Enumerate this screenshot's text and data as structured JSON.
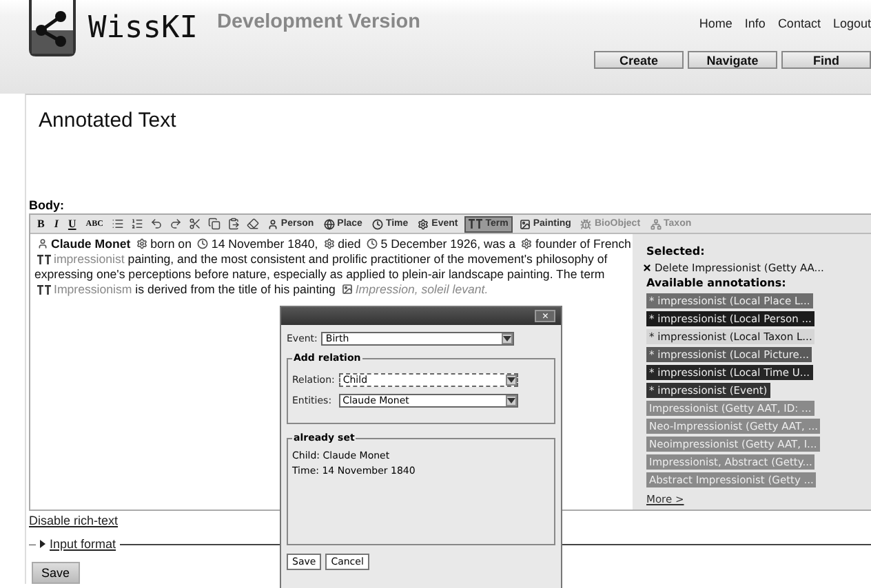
{
  "header": {
    "site_name": "WissKI",
    "subtitle": "Development Version",
    "links": [
      "Home",
      "Info",
      "Contact",
      "Logout"
    ],
    "buttons": [
      "Create",
      "Navigate",
      "Find"
    ]
  },
  "page": {
    "title": "Annotated Text",
    "body_label": "Body:"
  },
  "toolbar": {
    "format_buttons": [
      "B",
      "I",
      "U",
      "ABC"
    ],
    "annotation_buttons": [
      {
        "kind": "person",
        "label": "Person",
        "selected": false,
        "disabled": false
      },
      {
        "kind": "place",
        "label": "Place",
        "selected": false,
        "disabled": false
      },
      {
        "kind": "time",
        "label": "Time",
        "selected": false,
        "disabled": false
      },
      {
        "kind": "event",
        "label": "Event",
        "selected": false,
        "disabled": false
      },
      {
        "kind": "term",
        "label": "Term",
        "selected": true,
        "disabled": false
      },
      {
        "kind": "painting",
        "label": "Painting",
        "selected": false,
        "disabled": false
      },
      {
        "kind": "bio",
        "label": "BioObject",
        "selected": false,
        "disabled": true
      },
      {
        "kind": "taxon",
        "label": "Taxon",
        "selected": false,
        "disabled": true
      }
    ]
  },
  "editor": {
    "lines": [
      [
        {
          "kind": "person",
          "text": "Claude Monet"
        },
        {
          "kind": "event",
          "text": "born on"
        },
        {
          "kind": "time",
          "text": "14 November 1840,"
        },
        {
          "kind": "event",
          "text": "died"
        },
        {
          "kind": "time",
          "text": "5 December 1926, was a"
        },
        {
          "kind": "event",
          "text": "founder of French"
        }
      ],
      [
        {
          "kind": "term",
          "text": "impressionist"
        },
        {
          "kind": "text",
          "text": "painting, and the most consistent and prolific practitioner of the movement's philosophy of"
        }
      ],
      [
        {
          "kind": "text",
          "text": "expressing one's perceptions before nature, especially as applied to plein-air landscape painting. The term"
        }
      ],
      [
        {
          "kind": "term",
          "text": "Impressionism"
        },
        {
          "kind": "text",
          "text": "is derived from the title of his painting"
        },
        {
          "kind": "painting",
          "text": "Impression, soleil levant."
        }
      ]
    ]
  },
  "annotations": {
    "selected_label": "Selected:",
    "selected": [
      "Delete Impressionist (Getty AA..."
    ],
    "available_label": "Available annotations:",
    "available": [
      {
        "text": "* impressionist (Local Place L...",
        "color": "#6e6e6e"
      },
      {
        "text": "* impressionist (Local Person ...",
        "color": "#1c1c1c"
      },
      {
        "text": "* impressionist (Local Taxon L...",
        "color": "#d6d6d6"
      },
      {
        "text": "* impressionist (Local Picture...",
        "color": "#5a5a5a"
      },
      {
        "text": "* impressionist (Local Time U...",
        "color": "#262626"
      },
      {
        "text": "* impressionist (Event)",
        "color": "#333333"
      },
      {
        "text": "Impressionist (Getty AAT, ID: ...",
        "color": "#8a8a8a"
      },
      {
        "text": "Neo-Impressionist (Getty AAT, ...",
        "color": "#8a8a8a"
      },
      {
        "text": "Neoimpressionist (Getty AAT, I...",
        "color": "#8a8a8a"
      },
      {
        "text": "Impressionist, Abstract (Getty...",
        "color": "#8a8a8a"
      },
      {
        "text": "Abstract Impressionist (Getty ...",
        "color": "#8a8a8a"
      }
    ],
    "more": "More >"
  },
  "footer": {
    "disable_link": "Disable rich-text",
    "toggle": "–",
    "input_format": "Input format",
    "save": "Save"
  },
  "dialog": {
    "close": "×",
    "event_label": "Event:",
    "event_value": "Birth",
    "relation_legend": "Add relation",
    "relation_label": "Relation:",
    "relation_value": "Child",
    "entities_label": "Entities:",
    "entities_value": "Claude Monet",
    "set_legend": "already set",
    "set_items": [
      "Child: Claude Monet",
      "Time: 14 November 1840"
    ],
    "buttons": [
      "Save",
      "Cancel"
    ]
  }
}
